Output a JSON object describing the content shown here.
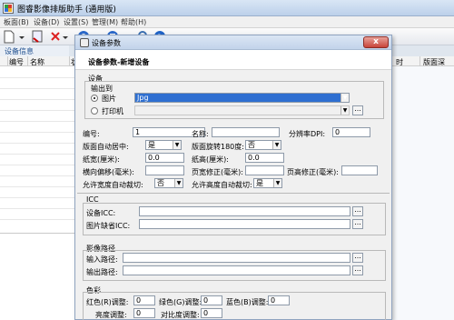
{
  "app": {
    "title": "图睿影像排版助手 (通用版)"
  },
  "menu": [
    "板面(B)",
    "设备(D)",
    "设置(S)",
    "管理(M)",
    "帮助(H)"
  ],
  "toolbar": {
    "icons": [
      "new-icon",
      "dropdown-icon",
      "save-icon",
      "delete-icon",
      "dropdown-icon",
      "refresh-icon",
      "dropdown-icon",
      "print-icon",
      "dropdown-icon",
      "search-icon",
      "help-icon"
    ]
  },
  "device_panel": {
    "title": "设备信息"
  },
  "table": {
    "columns_left": [
      "编号",
      "名称",
      "状"
    ],
    "columns_right": [
      "时",
      "版面深"
    ]
  },
  "dialog": {
    "title": "设备参数",
    "close_label": "x",
    "subtitle": "设备参数-新增设备",
    "device_section": {
      "title": "设备",
      "output_group": "输出到",
      "radio_image": "图片",
      "radio_printer": "打印机",
      "image_format": "Jpg",
      "printer_value": "",
      "printer_btn": "..."
    },
    "fields": {
      "id_label": "编号:",
      "id_value": "1",
      "name_label": "名称:",
      "name_value": "",
      "dpi_label": "分辨率DPI:",
      "dpi_value": "0",
      "center_label": "版面自动居中:",
      "center_value": "是",
      "rotate_label": "版面旋转180度:",
      "rotate_value": "否",
      "paper_width_label": "纸宽(厘米):",
      "paper_width_value": "0.0",
      "paper_height_label": "纸高(厘米):",
      "paper_height_value": "0.0",
      "h_offset_label": "横向偏移(毫米):",
      "h_offset_value": "",
      "page_correct_label": "页宽修正(毫米):",
      "page_correct_value": "",
      "height_correct_label": "页高修正(毫米):",
      "height_correct_value": "",
      "auto_width_label": "允许宽度自动裁切:",
      "auto_width_value": "否",
      "auto_height_label": "允许高度自动裁切:",
      "auto_height_value": "是"
    },
    "icc_section": {
      "title": "ICC",
      "device_icc_label": "设备ICC:",
      "device_icc_value": "",
      "image_icc_label": "图片缺省ICC:",
      "image_icc_value": "",
      "btn": "..."
    },
    "path_section": {
      "title": "影像路径",
      "input_label": "输入路径:",
      "input_value": "",
      "output_label": "输出路径:",
      "output_value": "",
      "btn": "..."
    },
    "color_section": {
      "title": "色彩",
      "red_label": "红色(R)调整:",
      "red_value": "0",
      "green_label": "绿色(G)调整:",
      "green_value": "0",
      "blue_label": "蓝色(B)调整:",
      "blue_value": "0",
      "brightness_label": "亮度调整:",
      "brightness_value": "0",
      "contrast_label": "对比度调整:",
      "contrast_value": "0"
    }
  }
}
